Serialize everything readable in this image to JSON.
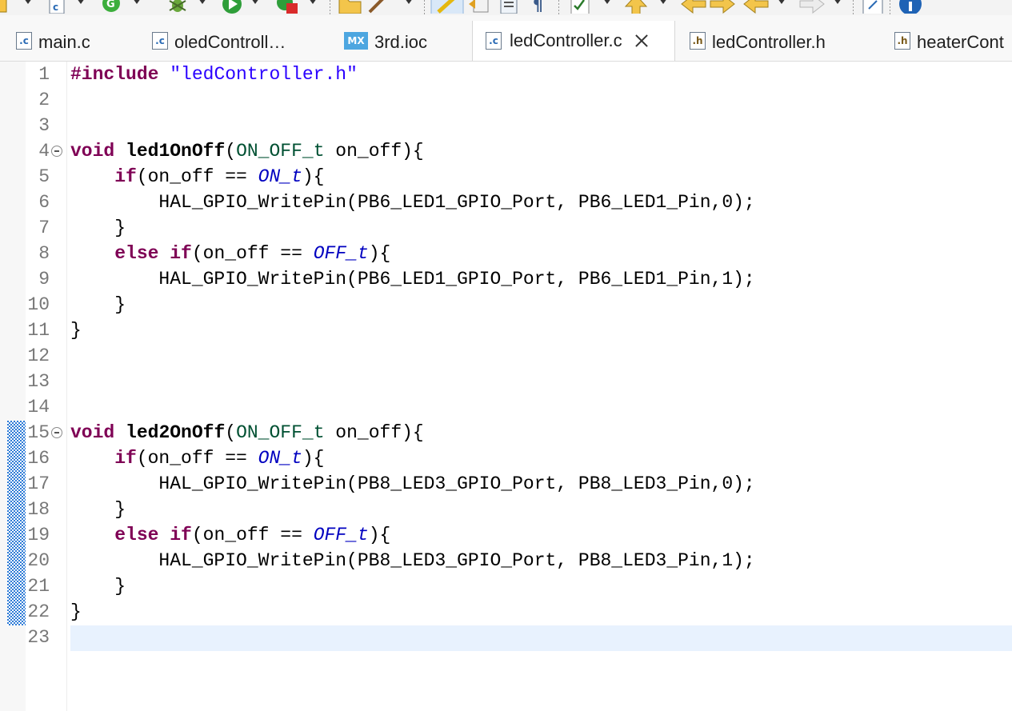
{
  "toolbar": {
    "icons": [
      "new-file-icon",
      "new-c-file-icon",
      "refresh-icon",
      "debug-icon",
      "run-icon",
      "external-tools-icon",
      "open-folder-icon",
      "wand-icon",
      "highlight-icon",
      "navigate-back-icon",
      "list-icon",
      "paragraph-icon",
      "tasks-icon",
      "up-icon",
      "prev-icon",
      "next-icon",
      "back-icon",
      "forward-icon",
      "open-perspective-icon",
      "info-icon"
    ]
  },
  "tabs": [
    {
      "label": "main.c",
      "icon": "c",
      "active": false
    },
    {
      "label": "oledControll…",
      "icon": "c",
      "active": false
    },
    {
      "label": "3rd.ioc",
      "icon": "MX",
      "active": false
    },
    {
      "label": "ledController.c",
      "icon": "c",
      "active": true
    },
    {
      "label": "ledController.h",
      "icon": "h",
      "active": false
    },
    {
      "label": "heaterCont",
      "icon": "h",
      "active": false
    }
  ],
  "editor": {
    "lines": [
      [
        {
          "t": "#include",
          "c": "kw"
        },
        {
          "t": " "
        },
        {
          "t": "\"ledController.h\"",
          "c": "str"
        }
      ],
      [],
      [],
      [
        {
          "t": "void",
          "c": "kw"
        },
        {
          "t": " "
        },
        {
          "t": "led1OnOff",
          "c": "fn"
        },
        {
          "t": "("
        },
        {
          "t": "ON_OFF_t",
          "c": "typ"
        },
        {
          "t": " on_off){"
        }
      ],
      [
        {
          "t": "    "
        },
        {
          "t": "if",
          "c": "kw"
        },
        {
          "t": "(on_off == "
        },
        {
          "t": "ON_t",
          "c": "enm"
        },
        {
          "t": "){"
        }
      ],
      [
        {
          "t": "        HAL_GPIO_WritePin(PB6_LED1_GPIO_Port, PB6_LED1_Pin,0);"
        }
      ],
      [
        {
          "t": "    }"
        }
      ],
      [
        {
          "t": "    "
        },
        {
          "t": "else",
          "c": "kw"
        },
        {
          "t": " "
        },
        {
          "t": "if",
          "c": "kw"
        },
        {
          "t": "(on_off == "
        },
        {
          "t": "OFF_t",
          "c": "enm"
        },
        {
          "t": "){"
        }
      ],
      [
        {
          "t": "        HAL_GPIO_WritePin(PB6_LED1_GPIO_Port, PB6_LED1_Pin,1);"
        }
      ],
      [
        {
          "t": "    }"
        }
      ],
      [
        {
          "t": "}"
        }
      ],
      [],
      [],
      [],
      [
        {
          "t": "void",
          "c": "kw"
        },
        {
          "t": " "
        },
        {
          "t": "led2OnOff",
          "c": "fn"
        },
        {
          "t": "("
        },
        {
          "t": "ON_OFF_t",
          "c": "typ"
        },
        {
          "t": " on_off){"
        }
      ],
      [
        {
          "t": "    "
        },
        {
          "t": "if",
          "c": "kw"
        },
        {
          "t": "(on_off == "
        },
        {
          "t": "ON_t",
          "c": "enm"
        },
        {
          "t": "){"
        }
      ],
      [
        {
          "t": "        HAL_GPIO_WritePin(PB8_LED3_GPIO_Port, PB8_LED3_Pin,0);"
        }
      ],
      [
        {
          "t": "    }"
        }
      ],
      [
        {
          "t": "    "
        },
        {
          "t": "else",
          "c": "kw"
        },
        {
          "t": " "
        },
        {
          "t": "if",
          "c": "kw"
        },
        {
          "t": "(on_off == "
        },
        {
          "t": "OFF_t",
          "c": "enm"
        },
        {
          "t": "){"
        }
      ],
      [
        {
          "t": "        HAL_GPIO_WritePin(PB8_LED3_GPIO_Port, PB8_LED3_Pin,1);"
        }
      ],
      [
        {
          "t": "    }"
        }
      ],
      [
        {
          "t": "}"
        }
      ],
      []
    ],
    "fold_lines": [
      4,
      15
    ],
    "current_line": 23,
    "colors": {
      "keyword": "#7f0055",
      "string": "#2a00ff",
      "type": "#005032",
      "enum": "#0000c0",
      "line_number": "#787878",
      "current_line_bg": "#e8f2fe",
      "change_marker": "#2e7bd6"
    }
  }
}
